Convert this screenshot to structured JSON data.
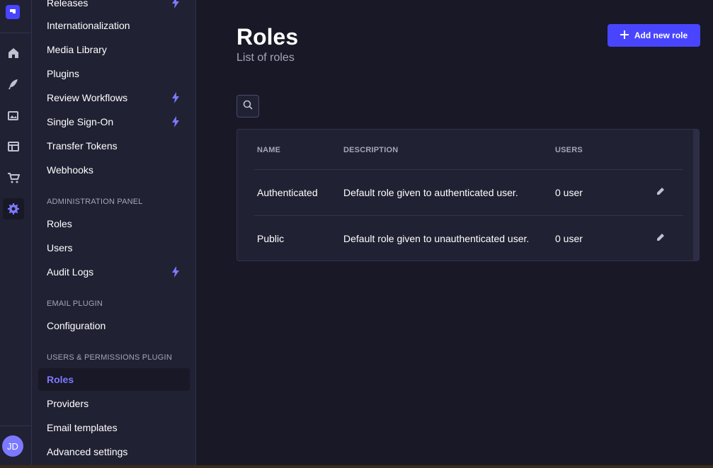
{
  "user": {
    "initials": "JD"
  },
  "rail": {
    "icons": [
      "logo-icon",
      "home-icon",
      "content-manager-icon",
      "media-library-icon",
      "content-type-builder-icon",
      "marketplace-icon",
      "settings-icon"
    ]
  },
  "settings_nav": {
    "items_top": [
      {
        "label": "Releases",
        "premium": true
      },
      {
        "label": "Internationalization",
        "premium": false
      },
      {
        "label": "Media Library",
        "premium": false
      },
      {
        "label": "Plugins",
        "premium": false
      },
      {
        "label": "Review Workflows",
        "premium": true
      },
      {
        "label": "Single Sign-On",
        "premium": true
      },
      {
        "label": "Transfer Tokens",
        "premium": false
      },
      {
        "label": "Webhooks",
        "premium": false
      }
    ],
    "admin_section": "ADMINISTRATION PANEL",
    "admin_items": [
      {
        "label": "Roles",
        "premium": false
      },
      {
        "label": "Users",
        "premium": false
      },
      {
        "label": "Audit Logs",
        "premium": true
      }
    ],
    "email_section": "EMAIL PLUGIN",
    "email_items": [
      {
        "label": "Configuration"
      }
    ],
    "up_section": "USERS & PERMISSIONS PLUGIN",
    "up_items": [
      {
        "label": "Roles",
        "active": true
      },
      {
        "label": "Providers"
      },
      {
        "label": "Email templates"
      },
      {
        "label": "Advanced settings"
      }
    ]
  },
  "header": {
    "title": "Roles",
    "subtitle": "List of roles",
    "add_button": "Add new role"
  },
  "table": {
    "columns": [
      "NAME",
      "DESCRIPTION",
      "USERS"
    ],
    "rows": [
      {
        "name": "Authenticated",
        "description": "Default role given to authenticated user.",
        "users": "0 user"
      },
      {
        "name": "Public",
        "description": "Default role given to unauthenticated user.",
        "users": "0 user"
      }
    ]
  },
  "colors": {
    "primary": "#4945ff",
    "active_text": "#7b79ff",
    "background": "#181826",
    "panel": "#212134"
  }
}
